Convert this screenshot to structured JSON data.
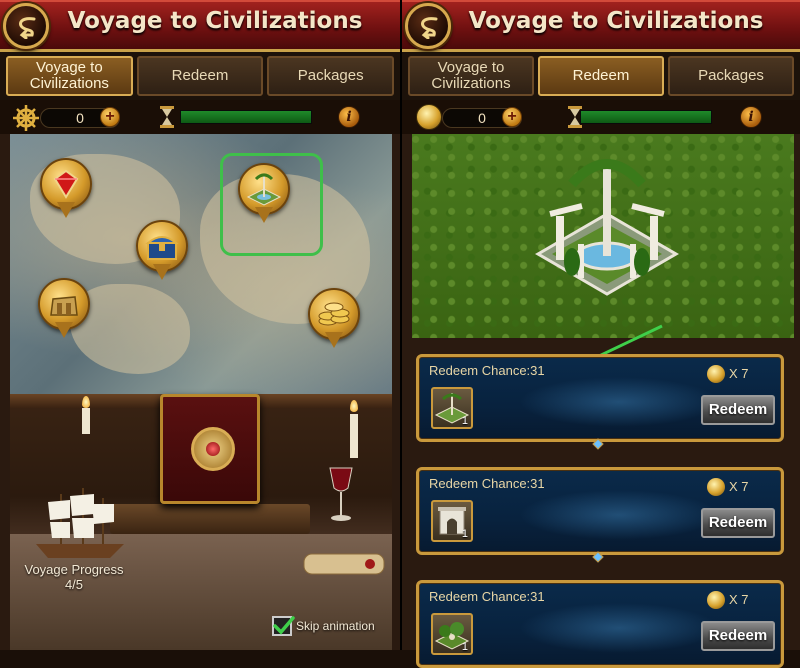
{
  "left": {
    "title": "Voyage to Civilizations",
    "tabs": [
      {
        "label": "Voyage to Civilizations",
        "active": true
      },
      {
        "label": "Redeem",
        "active": false
      },
      {
        "label": "Packages",
        "active": false
      }
    ],
    "currency": {
      "icon": "ship-wheel-icon",
      "count": "0"
    },
    "progress_fill": 1.0,
    "voyage_progress_label": "Voyage Progress",
    "voyage_progress_value": "4/5",
    "skip_animation_label": "Skip animation",
    "skip_checked": true
  },
  "right": {
    "title": "Voyage to Civilizations",
    "tabs": [
      {
        "label": "Voyage to Civilizations",
        "active": false
      },
      {
        "label": "Redeem",
        "active": true
      },
      {
        "label": "Packages",
        "active": false
      }
    ],
    "currency": {
      "icon": "coin-icon",
      "count": "0"
    },
    "progress_fill": 1.0,
    "cards": [
      {
        "chance": "Redeem Chance:31",
        "cost": "X 7",
        "qty": "1",
        "button": "Redeem",
        "item_icon": "fountain-garden-icon"
      },
      {
        "chance": "Redeem Chance:31",
        "cost": "X 7",
        "qty": "1",
        "button": "Redeem",
        "item_icon": "arch-monument-icon"
      },
      {
        "chance": "Redeem Chance:31",
        "cost": "X 7",
        "qty": "1",
        "button": "Redeem",
        "item_icon": "garden-icon"
      }
    ]
  },
  "colors": {
    "header_red": "#8a1c18",
    "gold": "#c9993c",
    "highlight_green": "#3fbf4a"
  }
}
